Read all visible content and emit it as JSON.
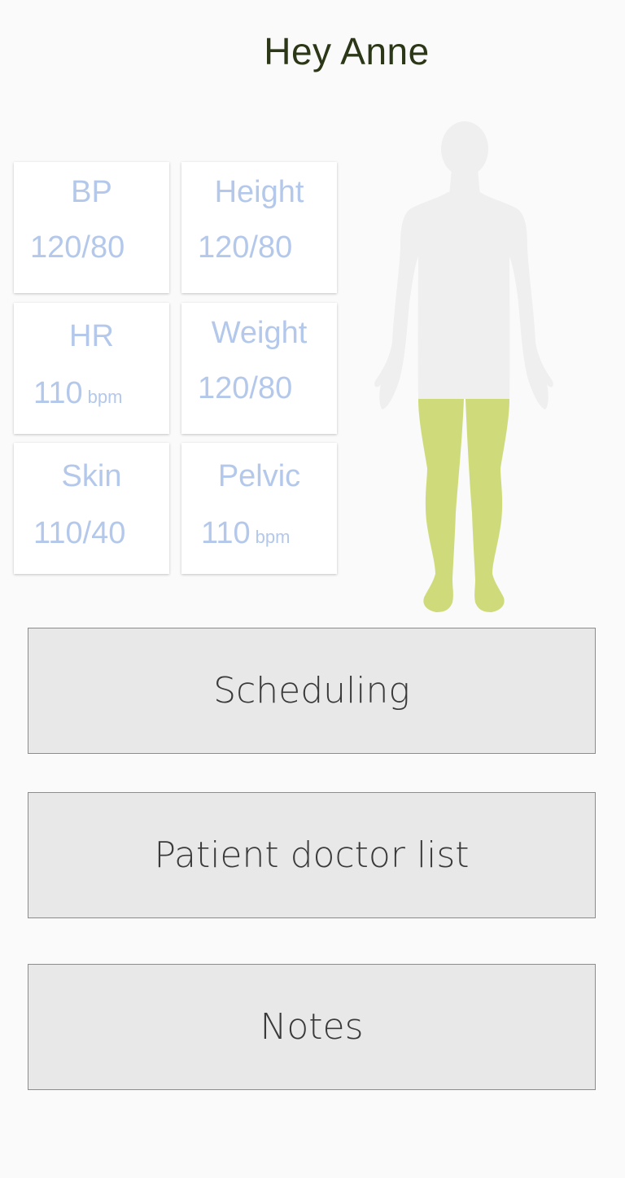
{
  "header": {
    "greeting": "Hey Anne"
  },
  "vitals": [
    {
      "label": "BP",
      "value": "120/80",
      "unit": ""
    },
    {
      "label": "Height",
      "value": "120/80",
      "unit": ""
    },
    {
      "label": "HR",
      "value": "110",
      "unit": "bpm"
    },
    {
      "label": "Weight",
      "value": "120/80",
      "unit": ""
    },
    {
      "label": "Skin",
      "value": "110/40",
      "unit": ""
    },
    {
      "label": "Pelvic",
      "value": "110",
      "unit": "bpm"
    }
  ],
  "body_map": {
    "icon": "human-body-icon",
    "highlighted_region": "legs",
    "body_color": "#efefef",
    "highlight_color": "#cfdb7b"
  },
  "menu": {
    "scheduling": "Scheduling",
    "doctor_list": "Patient doctor list",
    "notes": "Notes"
  },
  "colors": {
    "background": "#fafafa",
    "greeting_text": "#2b3717",
    "vital_text": "#b3c8ea",
    "button_bg": "#e8e8e8",
    "button_border": "#8c8c8c"
  }
}
